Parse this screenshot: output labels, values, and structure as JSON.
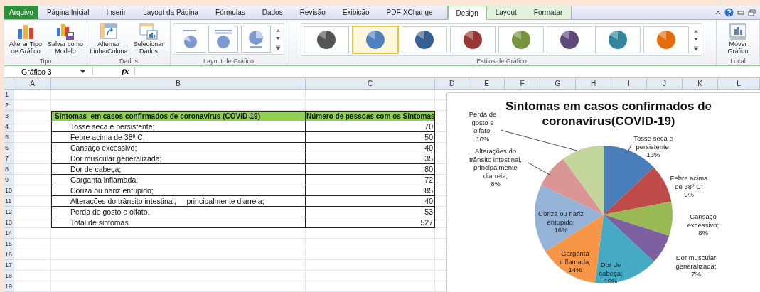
{
  "tabs": [
    {
      "label": "Arquivo",
      "kind": "file",
      "selected": false
    },
    {
      "label": "Página Inicial",
      "kind": "normal",
      "selected": false
    },
    {
      "label": "Inserir",
      "kind": "normal",
      "selected": false
    },
    {
      "label": "Layout da Página",
      "kind": "normal",
      "selected": false
    },
    {
      "label": "Fórmulas",
      "kind": "normal",
      "selected": false
    },
    {
      "label": "Dados",
      "kind": "normal",
      "selected": false
    },
    {
      "label": "Revisão",
      "kind": "normal",
      "selected": false
    },
    {
      "label": "Exibição",
      "kind": "normal",
      "selected": false
    },
    {
      "label": "PDF-XChange",
      "kind": "normal",
      "selected": false
    },
    {
      "label": "Design",
      "kind": "contextual",
      "selected": true
    },
    {
      "label": "Layout",
      "kind": "contextual",
      "selected": false
    },
    {
      "label": "Formatar",
      "kind": "contextual",
      "selected": false
    }
  ],
  "ribbon": {
    "groups": [
      {
        "label": "Tipo",
        "kind": "buttons",
        "items": [
          {
            "label": "Alterar Tipo de Gráfico"
          },
          {
            "label": "Salvar como Modelo"
          }
        ]
      },
      {
        "label": "Dados",
        "kind": "buttons",
        "items": [
          {
            "label": "Alternar Linha/Coluna"
          },
          {
            "label": "Selecionar Dados"
          }
        ]
      },
      {
        "label": "Layout de Gráfico",
        "kind": "layouts"
      },
      {
        "label": "Estilos de Gráfico",
        "kind": "styles",
        "items": [
          {
            "color": "#555555",
            "selected": false
          },
          {
            "color": "#4f81bd",
            "selected": true
          },
          {
            "color": "#365f91",
            "selected": false
          },
          {
            "color": "#953735",
            "selected": false
          },
          {
            "color": "#77933c",
            "selected": false
          },
          {
            "color": "#5f497a",
            "selected": false
          },
          {
            "color": "#31859c",
            "selected": false
          },
          {
            "color": "#e46c0a",
            "selected": false
          }
        ]
      },
      {
        "label": "Local",
        "kind": "buttons",
        "items": [
          {
            "label": "Mover Gráfico"
          }
        ]
      }
    ]
  },
  "formula_bar": {
    "name_box": "Gráfico 3",
    "fx": "fx"
  },
  "sheet": {
    "columns": [
      "A",
      "B",
      "C",
      "D",
      "E",
      "F",
      "G",
      "H",
      "I",
      "J",
      "K",
      "L"
    ],
    "row_numbers": [
      "1",
      "2",
      "3",
      "4",
      "5",
      "6",
      "7",
      "8",
      "9",
      "10",
      "11",
      "12",
      "13",
      "14",
      "15",
      "16",
      "17",
      "18",
      "19"
    ],
    "table": {
      "header": [
        "Sintomas  em casos confirmados de coronavírus (COVID-19)",
        "Número de pessoas com os Sintomas"
      ],
      "rows": [
        {
          "symptom": "Tosse seca e persistente;",
          "count": "70"
        },
        {
          "symptom": "Febre acima de 38º C;",
          "count": "50"
        },
        {
          "symptom": "Cansaço excessivo;",
          "count": "40"
        },
        {
          "symptom": "Dor muscular generalizada;",
          "count": "35"
        },
        {
          "symptom": "Dor de cabeça;",
          "count": "80"
        },
        {
          "symptom": "Garganta inflamada;",
          "count": "72"
        },
        {
          "symptom": "Coriza ou nariz entupido;",
          "count": "85"
        },
        {
          "symptom": "Alterações do trânsito intestinal,     principalmente diarreia;",
          "count": "40"
        },
        {
          "symptom": "Perda de gosto e olfato.",
          "count": "53"
        }
      ],
      "total": {
        "label": "Total de sintomas",
        "value": "527"
      }
    }
  },
  "chart": {
    "chart_data": {
      "type": "pie",
      "title": "Sintomas em casos confirmados de coronavírus(COVID-19)",
      "categories": [
        "Tosse seca e persistente",
        "Febre acima de 38º C",
        "Cansaço excessivo",
        "Dor muscular generalizada",
        "Dor de cabeça",
        "Garganta inflamada",
        "Coriza ou nariz entupido",
        "Alterações do trânsito intestinal, principalmente diarreia",
        "Perda de gosto e olfato."
      ],
      "values": [
        13,
        9,
        8,
        7,
        15,
        14,
        16,
        8,
        10
      ],
      "colors": [
        "#4a7ebb",
        "#be4b48",
        "#98b954",
        "#7d60a0",
        "#46aac5",
        "#f79646",
        "#95b3d7",
        "#d99694",
        "#c3d69b"
      ],
      "value_labels": [
        "13%",
        "9%",
        "8%",
        "7%",
        "15%",
        "14%",
        "16%",
        "8%",
        "10%"
      ]
    },
    "label_separator": ";"
  }
}
